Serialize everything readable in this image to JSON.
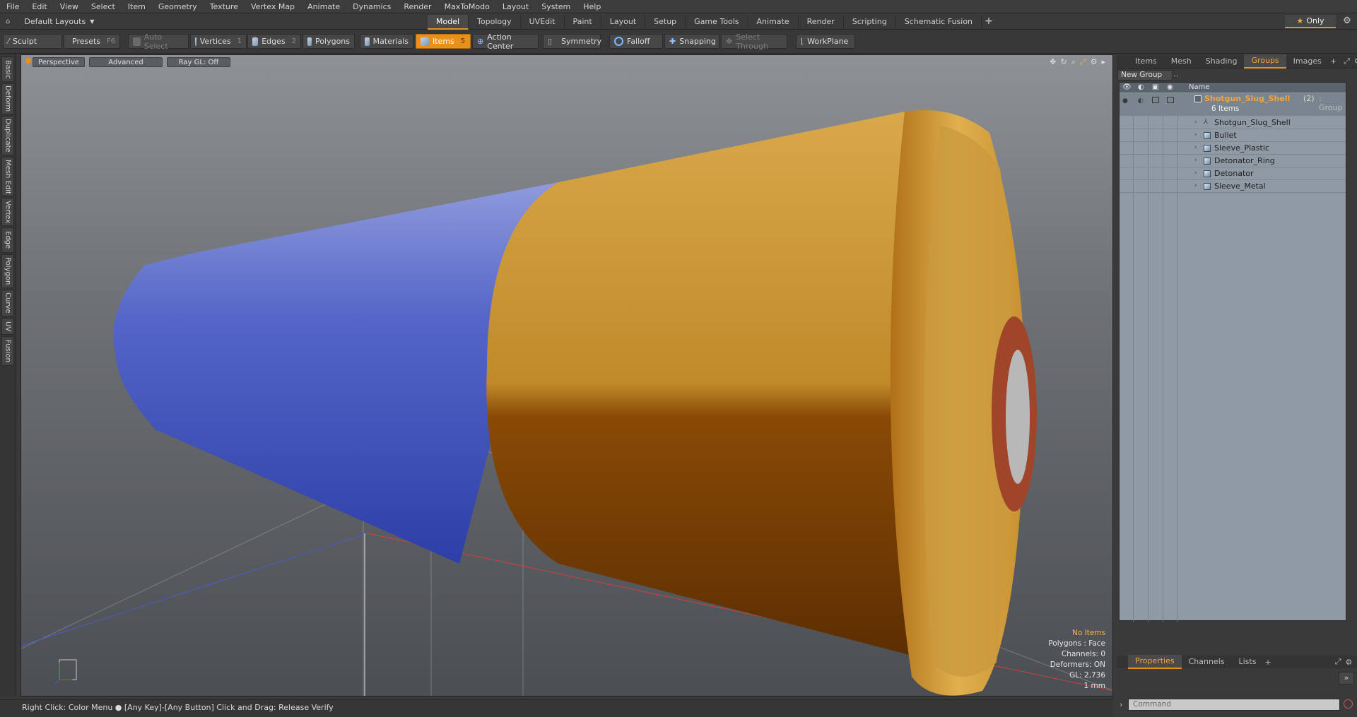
{
  "menu": [
    "File",
    "Edit",
    "View",
    "Select",
    "Item",
    "Geometry",
    "Texture",
    "Vertex Map",
    "Animate",
    "Dynamics",
    "Render",
    "MaxToModo",
    "Layout",
    "System",
    "Help"
  ],
  "layout_selector": "Default Layouts",
  "layout_tabs": [
    "Model",
    "Topology",
    "UVEdit",
    "Paint",
    "Layout",
    "Setup",
    "Game Tools",
    "Animate",
    "Render",
    "Scripting",
    "Schematic Fusion"
  ],
  "only_label": "Only",
  "toolbar": {
    "sculpt": "Sculpt",
    "presets": "Presets",
    "presets_key": "F6",
    "auto_select": "Auto Select",
    "vertices": "Vertices",
    "vertices_key": "1",
    "edges": "Edges",
    "edges_key": "2",
    "polygons": "Polygons",
    "materials": "Materials",
    "items": "Items",
    "items_key": "5",
    "action_center": "Action Center",
    "symmetry": "Symmetry",
    "falloff": "Falloff",
    "snapping": "Snapping",
    "select_through": "Select Through",
    "workplane": "WorkPlane"
  },
  "left_tabs": [
    "Basic",
    "Deform",
    "Duplicate",
    "Mesh Edit",
    "Vertex",
    "Edge",
    "Polygon",
    "Curve",
    "UV",
    "Fusion"
  ],
  "viewport": {
    "view": "Perspective",
    "shading": "Advanced",
    "raygl": "Ray GL: Off",
    "info": {
      "items": "No Items",
      "polygons": "Polygons : Face",
      "channels": "Channels: 0",
      "deformers": "Deformers: ON",
      "gl": "GL: 2,736",
      "unit": "1 mm"
    }
  },
  "right_tabs": [
    "Items",
    "Mesh ...",
    "Shading",
    "Groups",
    "Images"
  ],
  "new_group": "New Group",
  "list_header": "Name",
  "group": {
    "name": "Shotgun_Slug_Shell",
    "count": "(2)",
    "type": ": Group",
    "items_count": "6 Items"
  },
  "children": [
    "Shotgun_Slug_Shell",
    "Bullet",
    "Sleeve_Plastic",
    "Detonator_Ring",
    "Detonator",
    "Sleeve_Metal"
  ],
  "bottom_tabs": [
    "Properties",
    "Channels",
    "Lists"
  ],
  "command_placeholder": "Command",
  "status": "Right Click: Color Menu ● [Any Key]-[Any Button] Click and Drag: Release Verify",
  "colors": {
    "accent": "#e8901c",
    "blue_sleeve": "#4a5fc0",
    "brass": "#c88a2a"
  }
}
